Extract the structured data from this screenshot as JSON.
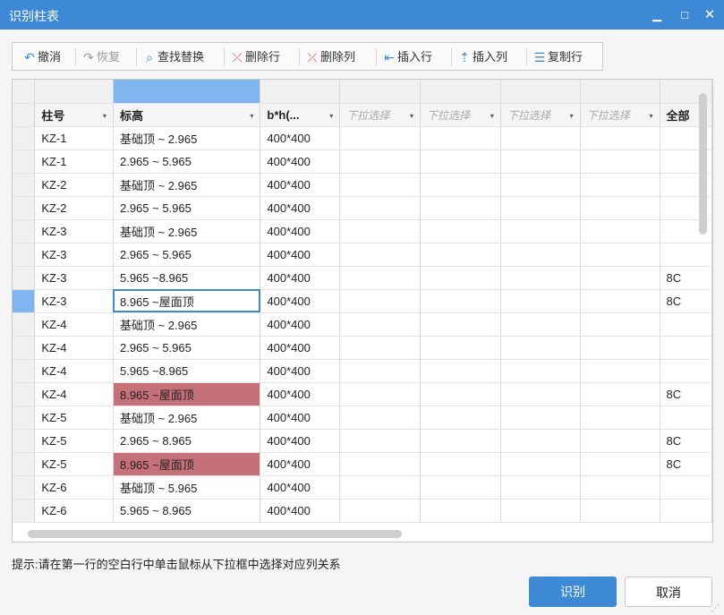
{
  "window": {
    "title": "识别柱表",
    "min_glyph": "▁",
    "max_glyph": "□",
    "close_glyph": "✕"
  },
  "toolbar": {
    "undo": "撤消",
    "redo": "恢复",
    "find_replace": "查找替换",
    "delete_row": "删除行",
    "delete_col": "删除列",
    "insert_row": "插入行",
    "insert_col": "插入列",
    "copy_row": "复制行"
  },
  "icons": {
    "undo": "↶",
    "redo": "↷",
    "find_replace": "⌕",
    "delete_row": "⤫",
    "delete_col": "⤫",
    "insert_row": "⇤",
    "insert_col": "⇡",
    "copy_row": "☰"
  },
  "grid": {
    "headers": [
      "柱号",
      "标高",
      "b*h(...",
      "下拉选择",
      "下拉选择",
      "下拉选择",
      "下拉选择",
      "全部"
    ],
    "dropdown_glyph": "▾",
    "rows": [
      [
        "KZ-1",
        "基础顶 ~ 2.965",
        "400*400",
        "",
        "",
        "",
        "",
        ""
      ],
      [
        "KZ-1",
        "2.965 ~ 5.965",
        "400*400",
        "",
        "",
        "",
        "",
        ""
      ],
      [
        "KZ-2",
        "基础顶 ~ 2.965",
        "400*400",
        "",
        "",
        "",
        "",
        ""
      ],
      [
        "KZ-2",
        "2.965 ~ 5.965",
        "400*400",
        "",
        "",
        "",
        "",
        ""
      ],
      [
        "KZ-3",
        "基础顶 ~ 2.965",
        "400*400",
        "",
        "",
        "",
        "",
        ""
      ],
      [
        "KZ-3",
        "2.965 ~ 5.965",
        "400*400",
        "",
        "",
        "",
        "",
        ""
      ],
      [
        "KZ-3",
        "5.965 ~8.965",
        "400*400",
        "",
        "",
        "",
        "",
        "8C"
      ],
      [
        "KZ-3",
        "8.965 ~屋面顶",
        "400*400",
        "",
        "",
        "",
        "",
        "8C"
      ],
      [
        "KZ-4",
        "基础顶 ~ 2.965",
        "400*400",
        "",
        "",
        "",
        "",
        ""
      ],
      [
        "KZ-4",
        "2.965 ~ 5.965",
        "400*400",
        "",
        "",
        "",
        "",
        ""
      ],
      [
        "KZ-4",
        "5.965 ~8.965",
        "400*400",
        "",
        "",
        "",
        "",
        ""
      ],
      [
        "KZ-4",
        "8.965 ~屋面顶",
        "400*400",
        "",
        "",
        "",
        "",
        "8C"
      ],
      [
        "KZ-5",
        "基础顶 ~ 2.965",
        "400*400",
        "",
        "",
        "",
        "",
        ""
      ],
      [
        "KZ-5",
        "2.965 ~ 8.965",
        "400*400",
        "",
        "",
        "",
        "",
        "8C"
      ],
      [
        "KZ-5",
        "8.965 ~屋面顶",
        "400*400",
        "",
        "",
        "",
        "",
        "8C"
      ],
      [
        "KZ-6",
        "基础顶 ~ 5.965",
        "400*400",
        "",
        "",
        "",
        "",
        ""
      ],
      [
        "KZ-6",
        "5.965 ~ 8.965",
        "400*400",
        "",
        "",
        "",
        "",
        ""
      ]
    ],
    "selected_row": 7,
    "focused_cell": [
      7,
      1
    ],
    "highlighted_cells": [
      [
        11,
        1
      ],
      [
        14,
        1
      ]
    ],
    "highlight_color": "#c6707a",
    "selection_color": "#7fb6ef"
  },
  "hint": "提示:请在第一行的空白行中单击鼠标从下拉框中选择对应列关系",
  "buttons": {
    "ok": "识别",
    "cancel": "取消"
  },
  "colors": {
    "accent": "#3d89d6"
  }
}
